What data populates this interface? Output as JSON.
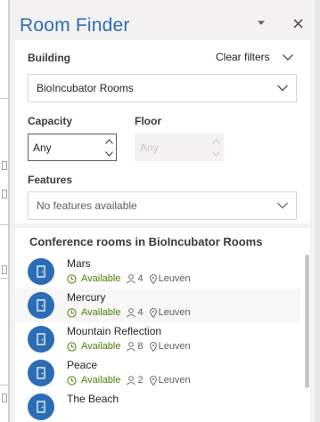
{
  "pane": {
    "title": "Room Finder",
    "accent_color": "#2b6cb7"
  },
  "filters": {
    "building_label": "Building",
    "clear_filters_label": "Clear filters",
    "building_value": "BioIncubator Rooms",
    "capacity_label": "Capacity",
    "capacity_value": "Any",
    "floor_label": "Floor",
    "floor_value": "Any",
    "features_label": "Features",
    "features_value": "No features available"
  },
  "results": {
    "title": "Conference rooms in BioIncubator Rooms",
    "available_color": "#498205",
    "rooms": [
      {
        "name": "Mars",
        "status": "Available",
        "capacity": "4",
        "location": "Leuven"
      },
      {
        "name": "Mercury",
        "status": "Available",
        "capacity": "4",
        "location": "Leuven"
      },
      {
        "name": "Mountain Reflection",
        "status": "Available",
        "capacity": "8",
        "location": "Leuven"
      },
      {
        "name": "Peace",
        "status": "Available",
        "capacity": "2",
        "location": "Leuven"
      },
      {
        "name": "The Beach"
      }
    ]
  },
  "icons": {
    "dropdown": "caret-down-icon",
    "close": "close-icon",
    "room": "door-icon",
    "clock": "clock-icon",
    "person": "person-icon",
    "pin": "location-pin-icon"
  }
}
